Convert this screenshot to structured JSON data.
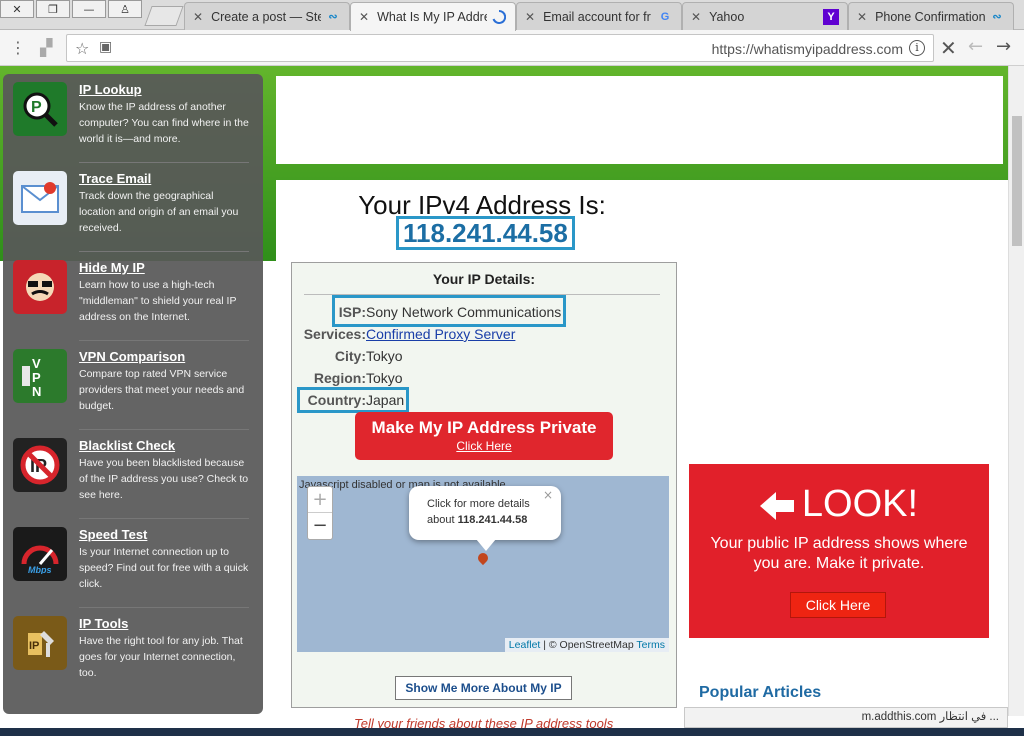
{
  "browser": {
    "tabs": [
      {
        "title": "Create a post — Ste",
        "icon": "steemit-icon"
      },
      {
        "title": "What Is My IP Addre",
        "icon": "loading-icon",
        "active": true
      },
      {
        "title": "Email account for fr",
        "icon": "google-icon"
      },
      {
        "title": "Yahoo",
        "icon": "yahoo-icon"
      },
      {
        "title": "Phone Confirmation",
        "icon": "steemit-icon"
      }
    ],
    "url": "https://whatismyipaddress.com"
  },
  "sidebar": {
    "items": [
      {
        "title": "IP Lookup",
        "desc": "Know the IP address of another computer? You can find where in the world it is—and more.",
        "icon": "ip-lookup-icon",
        "color": "#2a9a3c"
      },
      {
        "title": "Trace Email",
        "desc": "Track down the geographical location and origin of an email you received.",
        "icon": "trace-email-icon",
        "color": "#3f8fd8"
      },
      {
        "title": "Hide My IP",
        "desc": "Learn how to use a high-tech \"middleman\" to shield your real IP address on the Internet.",
        "icon": "hide-ip-icon",
        "color": "#c8232b"
      },
      {
        "title": "VPN Comparison",
        "desc": "Compare top rated VPN service providers that meet your needs and budget.",
        "icon": "vpn-icon",
        "color": "#2c7a2c"
      },
      {
        "title": "Blacklist Check",
        "desc": "Have you been blacklisted because of the IP address you use? Check to see here.",
        "icon": "blacklist-icon",
        "color": "#222222"
      },
      {
        "title": "Speed Test",
        "desc": "Is your Internet connection up to speed? Find out for free with a quick click.",
        "icon": "speed-test-icon",
        "color": "#1a1a1a"
      },
      {
        "title": "IP Tools",
        "desc": "Have the right tool for any job. That goes for your Internet connection, too.",
        "icon": "ip-tools-icon",
        "color": "#7a5a18"
      }
    ]
  },
  "main": {
    "heading": "Your IPv4 Address Is:",
    "ip": "118.241.44.58",
    "details": {
      "title": "Your IP Details:",
      "isp_label": "ISP:",
      "isp": "Sony Network Communications",
      "services_label": "Services:",
      "services": "Confirmed Proxy Server",
      "city_label": "City:",
      "city": "Tokyo",
      "region_label": "Region:",
      "region": "Tokyo",
      "country_label": "Country:",
      "country": "Japan"
    },
    "private_button": {
      "title": "Make My IP Address Private",
      "sub": "Click Here"
    },
    "map": {
      "note": "Javascript disabled or map is not available.",
      "zoom_in": "+",
      "zoom_out": "−",
      "popup_line1": "Click for more details",
      "popup_line2_prefix": "about ",
      "popup_ip": "118.241.44.58",
      "popup_close": "×",
      "attribution_leaflet": "Leaflet",
      "attribution_middle": " | © OpenStreetMap ",
      "attribution_terms": "Terms"
    },
    "more_button": "Show Me More About My IP",
    "look_panel": {
      "headline": "LOOK!",
      "text": "Your public IP address shows where you are. Make it private.",
      "button": "Click Here"
    },
    "popular": "Popular Articles",
    "tell": "Tell your friends about these IP address tools"
  },
  "status": "m.addthis.com في انتظار ..."
}
